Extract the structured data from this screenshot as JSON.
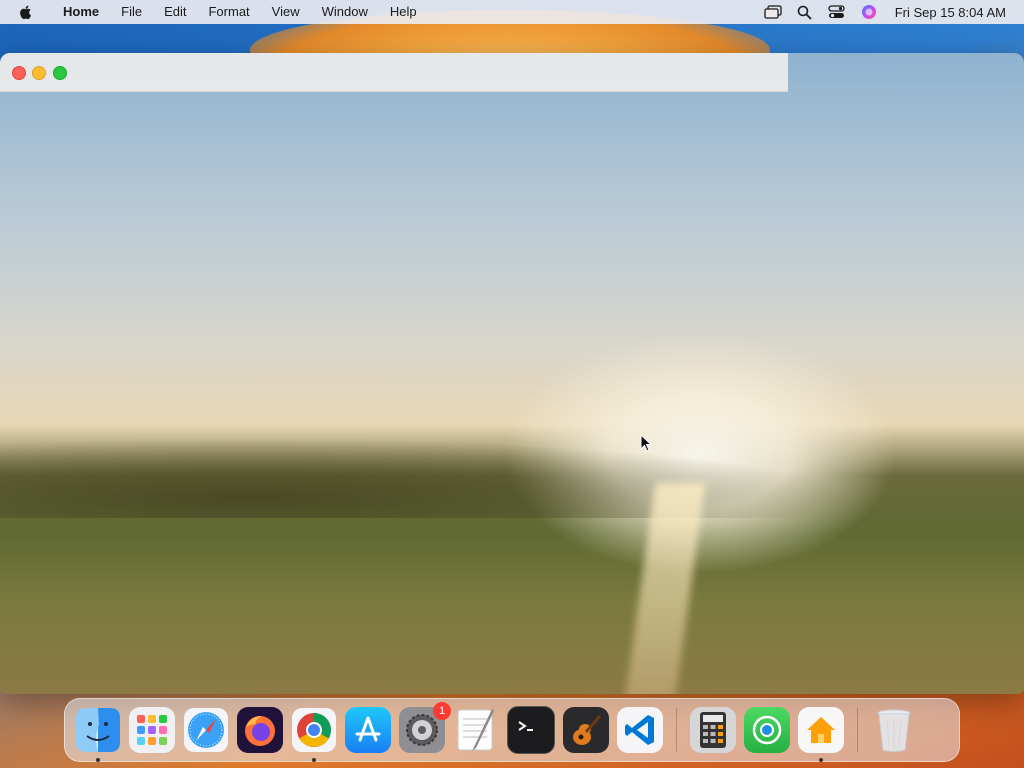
{
  "menubar": {
    "app_name": "Home",
    "menus": [
      "File",
      "Edit",
      "Format",
      "View",
      "Window",
      "Help"
    ],
    "clock": "Fri Sep 15  8:04 AM",
    "status_icons": [
      "screen-mirroring-icon",
      "search-icon",
      "control-center-icon",
      "siri-icon"
    ]
  },
  "window": {
    "buttons": [
      "close",
      "minimize",
      "zoom"
    ]
  },
  "dock": {
    "apps": [
      {
        "name": "Finder",
        "icon": "finder-icon",
        "running": true
      },
      {
        "name": "Launchpad",
        "icon": "launchpad-icon",
        "running": false
      },
      {
        "name": "Safari",
        "icon": "safari-icon",
        "running": false
      },
      {
        "name": "Firefox",
        "icon": "firefox-icon",
        "running": false
      },
      {
        "name": "Chrome",
        "icon": "chrome-icon",
        "running": true
      },
      {
        "name": "App Store",
        "icon": "app-store-icon",
        "running": false
      },
      {
        "name": "System Settings",
        "icon": "system-settings-icon",
        "running": false,
        "badge": "1"
      },
      {
        "name": "TextEdit",
        "icon": "textedit-icon",
        "running": false
      },
      {
        "name": "Terminal",
        "icon": "terminal-icon",
        "running": false
      },
      {
        "name": "GarageBand",
        "icon": "garageband-icon",
        "running": false
      },
      {
        "name": "VS Code",
        "icon": "vscode-icon",
        "running": false
      },
      {
        "name": "Calculator",
        "icon": "calculator-icon",
        "running": false
      },
      {
        "name": "Find My",
        "icon": "find-my-icon",
        "running": false
      },
      {
        "name": "Home",
        "icon": "home-icon",
        "running": true
      },
      {
        "name": "Trash",
        "icon": "trash-icon",
        "running": false
      }
    ]
  },
  "colors": {
    "close": "#fe5f57",
    "minimize": "#febc2e",
    "zoom": "#28c840",
    "badge": "#fe3b30"
  }
}
